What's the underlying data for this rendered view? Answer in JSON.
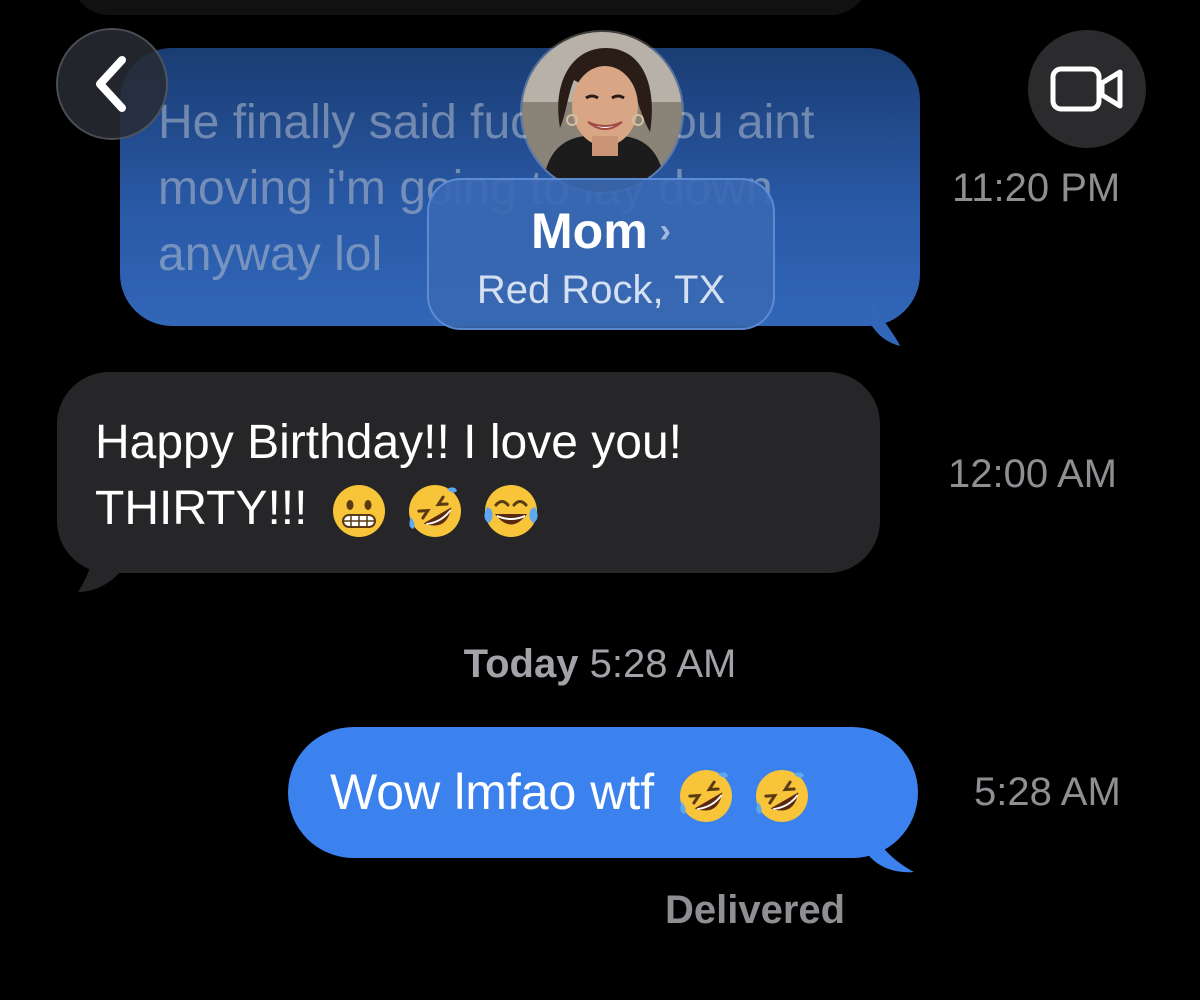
{
  "header": {
    "back_label": "Back",
    "contact": {
      "name": "Mom",
      "location": "Red Rock, TX"
    }
  },
  "messages": [
    {
      "direction": "outgoing",
      "text": "He finally said fuck it if you aint moving i'm going to lay down anyway lol",
      "visible_fragments": [
        "He finally saic",
        "it if you",
        "aint movin",
        "lay",
        "down any",
        "ay lol"
      ],
      "timestamp": "11:20 PM"
    },
    {
      "direction": "incoming",
      "line1": "Happy Birthday!! I love you!",
      "line2": "THIRTY!!!",
      "emojis": [
        "grimacing-face",
        "rolling-on-floor-laughing",
        "face-with-tears-of-joy"
      ],
      "timestamp": "12:00 AM"
    },
    {
      "direction": "outgoing",
      "text": "Wow lmfao wtf",
      "emojis": [
        "rolling-on-floor-laughing",
        "rolling-on-floor-laughing"
      ],
      "timestamp": "5:28 AM",
      "status": "Delivered"
    }
  ],
  "date_divider": {
    "day": "Today",
    "time": "5:28 AM"
  },
  "colors": {
    "background": "#000000",
    "outgoing_bubble": "#3b82ee",
    "incoming_bubble": "#262628",
    "timestamp": "#8e8e93"
  },
  "icons": {
    "back": "chevron-left-icon",
    "video": "video-camera-icon"
  }
}
